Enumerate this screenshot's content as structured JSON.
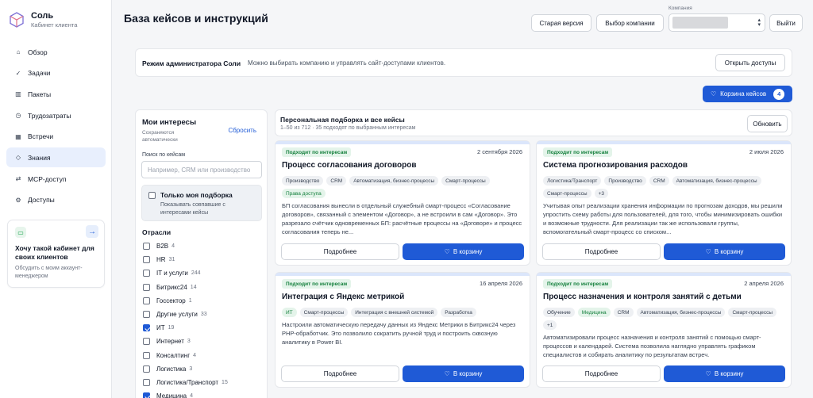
{
  "brand": {
    "name": "Соль",
    "subtitle": "Кабинет клиента"
  },
  "nav": [
    {
      "label": "Обзор",
      "icon": "⌂"
    },
    {
      "label": "Задачи",
      "icon": "✓"
    },
    {
      "label": "Пакеты",
      "icon": "▥"
    },
    {
      "label": "Трудозатраты",
      "icon": "◷"
    },
    {
      "label": "Встречи",
      "icon": "▦"
    },
    {
      "label": "Знания",
      "icon": "◇",
      "active": true
    },
    {
      "label": "MCP-доступ",
      "icon": "⇄"
    },
    {
      "label": "Доступы",
      "icon": "⚙"
    }
  ],
  "promo": {
    "title": "Хочу такой кабинет для своих клиентов",
    "text": "Обсудить с моим аккаунт-менеджером"
  },
  "header": {
    "title": "База кейсов и инструкций",
    "old_version": "Старая версия",
    "choose_company": "Выбор компании",
    "company_label": "Компания",
    "logout": "Выйти"
  },
  "admin": {
    "title": "Режим администратора Соли",
    "text": "Можно выбирать компанию и управлять сайт-доступами клиентов.",
    "open_access": "Открыть доступы"
  },
  "cart": {
    "label": "Корзина кейсов",
    "count": "4"
  },
  "interests": {
    "title": "Мои интересы",
    "subtitle": "Сохраняются автоматически",
    "reset": "Сбросить",
    "search_label": "Поиск по кейсам",
    "search_placeholder": "Например, CRM или производство",
    "only_mine_title": "Только моя подборка",
    "only_mine_text": "Показывать совпавшие с интересами кейсы",
    "industries_title": "Отрасли",
    "industries": [
      {
        "label": "B2B",
        "count": "4",
        "checked": false
      },
      {
        "label": "HR",
        "count": "31",
        "checked": false
      },
      {
        "label": "IT и услуги",
        "count": "244",
        "checked": false
      },
      {
        "label": "Битрикс24",
        "count": "14",
        "checked": false
      },
      {
        "label": "Госсектор",
        "count": "1",
        "checked": false
      },
      {
        "label": "Другие услуги",
        "count": "33",
        "checked": false
      },
      {
        "label": "ИТ",
        "count": "19",
        "checked": true
      },
      {
        "label": "Интернет",
        "count": "3",
        "checked": false
      },
      {
        "label": "Консалтинг",
        "count": "4",
        "checked": false
      },
      {
        "label": "Логистика",
        "count": "3",
        "checked": false
      },
      {
        "label": "Логистика/Транспорт",
        "count": "15",
        "checked": false
      },
      {
        "label": "Медицина",
        "count": "4",
        "checked": true
      }
    ]
  },
  "feed": {
    "title": "Персональная подборка и все кейсы",
    "subtitle": "1–50 из 712 · 35 подходят по выбранным интересам",
    "refresh": "Обновить"
  },
  "card_labels": {
    "match": "Подходит по интересам",
    "more": "Подробнее",
    "add": "В корзину"
  },
  "cards": [
    {
      "date": "2 сентября 2026",
      "title": "Процесс согласования договоров",
      "tags": [
        {
          "t": "Производство"
        },
        {
          "t": "CRM"
        },
        {
          "t": "Автоматизация, бизнес-процессы"
        },
        {
          "t": "Смарт-процессы"
        },
        {
          "t": "Права доступа",
          "green": true
        }
      ],
      "desc": "БП согласования вынесли в отдельный служебный смарт-процесс «Согласование договоров», связанный с элементом «Договор», а не встроили в сам «Договор». Это разрезало счётчик одновременных БП: расчётные процессы на «Договоре» и процесс согласования теперь не..."
    },
    {
      "date": "2 июля 2026",
      "title": "Система прогнозирования расходов",
      "tags": [
        {
          "t": "Логистика/Транспорт"
        },
        {
          "t": "Производство"
        },
        {
          "t": "CRM"
        },
        {
          "t": "Автоматизация, бизнес-процессы"
        },
        {
          "t": "Смарт-процессы"
        },
        {
          "t": "+3"
        }
      ],
      "desc": "Учитывая опыт реализации хранения информации по прогнозам доходов, мы решили упростить схему работы для пользователей, для того, чтобы минимизировать ошибки и возможные трудности. Для реализации так же использовали группы, вспомогательный смарт-процесс со списком..."
    },
    {
      "date": "16 апреля 2026",
      "title": "Интеграция с Яндекс метрикой",
      "tags": [
        {
          "t": "ИТ",
          "green": true
        },
        {
          "t": "Смарт-процессы"
        },
        {
          "t": "Интеграция с внешней системой"
        },
        {
          "t": "Разработка"
        }
      ],
      "desc": "Настроили автоматическую передачу данных из Яндекс Метрики в Битрикс24 через PHP-обработчик. Это позволило сократить ручной труд и построить сквозную аналитику в Power BI."
    },
    {
      "date": "2 апреля 2026",
      "title": "Процесс назначения и контроля занятий с детьми",
      "tags": [
        {
          "t": "Обучение"
        },
        {
          "t": "Медицина",
          "green": true
        },
        {
          "t": "CRM"
        },
        {
          "t": "Автоматизация, бизнес-процессы"
        },
        {
          "t": "Смарт-процессы"
        },
        {
          "t": "+1"
        }
      ],
      "desc": "Автоматизировали процесс назначения и контроля занятий с помощью смарт-процессов и календарей. Система позволила наглядно управлять графиком специалистов и собирать аналитику по результатам встреч."
    }
  ]
}
